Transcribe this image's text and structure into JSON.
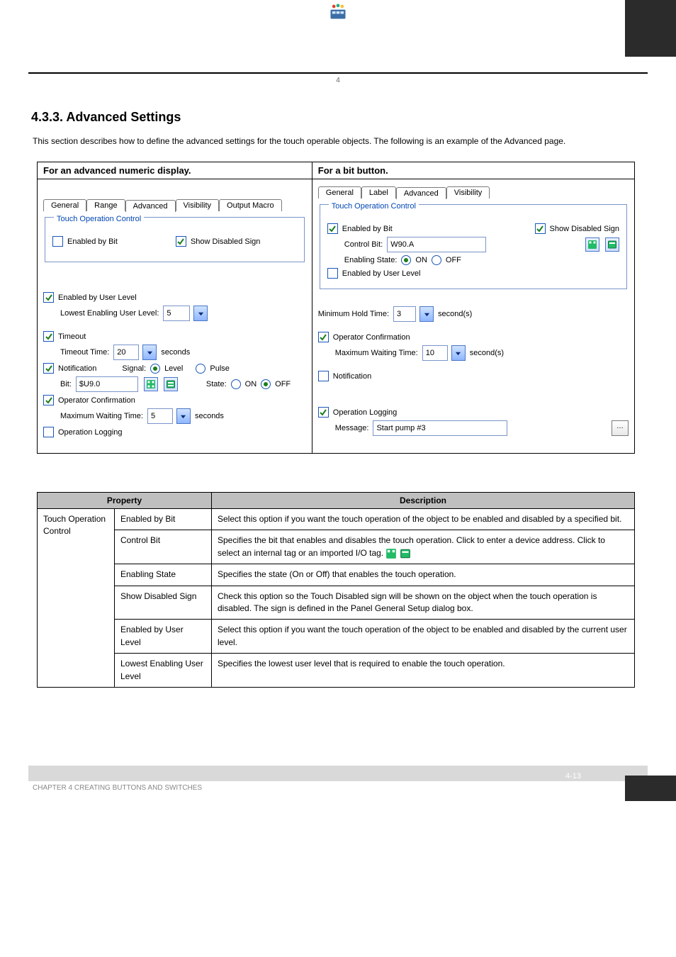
{
  "header": {
    "caption": "4",
    "top_right_page": ""
  },
  "section": {
    "number_title": "4.3.3. Advanced Settings",
    "description": "This section describes how to define the advanced settings for the touch operable objects. The following is an example of the Advanced page."
  },
  "shots": {
    "left_header": "For an advanced numeric display.",
    "right_header": "For a bit button.",
    "left": {
      "tabs": [
        "General",
        "Range",
        "Advanced",
        "Visibility",
        "Output Macro"
      ],
      "active_tab": "Advanced",
      "group_title": "Touch Operation Control",
      "enabled_by_bit": {
        "label": "Enabled by Bit",
        "checked": false
      },
      "show_disabled_sign": {
        "label": "Show Disabled Sign",
        "checked": true
      },
      "enabled_by_user_level": {
        "label": "Enabled by User Level",
        "checked": true
      },
      "lowest_level_label": "Lowest Enabling User Level:",
      "lowest_level_value": "5",
      "timeout": {
        "label": "Timeout",
        "checked": true
      },
      "timeout_time_label": "Timeout Time:",
      "timeout_time_value": "20",
      "timeout_seconds": "seconds",
      "notification": {
        "label": "Notification",
        "checked": true
      },
      "signal_label": "Signal:",
      "signal_options": [
        "Level",
        "Pulse"
      ],
      "signal_sel": "Level",
      "bit_label": "Bit:",
      "bit_value": "$U9.0",
      "state_label": "State:",
      "state_options": [
        "ON",
        "OFF"
      ],
      "state_sel": "OFF",
      "op_confirm": {
        "label": "Operator Confirmation",
        "checked": true
      },
      "max_wait_label": "Maximum Waiting Time:",
      "max_wait_value": "5",
      "max_wait_seconds": "seconds",
      "op_logging": {
        "label": "Operation Logging",
        "checked": false
      }
    },
    "right": {
      "tabs": [
        "General",
        "Label",
        "Advanced",
        "Visibility"
      ],
      "active_tab": "Advanced",
      "group_title": "Touch Operation Control",
      "enabled_by_bit": {
        "label": "Enabled by Bit",
        "checked": true
      },
      "show_disabled_sign": {
        "label": "Show Disabled Sign",
        "checked": true
      },
      "control_bit_label": "Control Bit:",
      "control_bit_value": "W90.A",
      "enabling_state_label": "Enabling State:",
      "enabling_state_options": [
        "ON",
        "OFF"
      ],
      "enabling_state_sel": "ON",
      "enabled_by_user_level": {
        "label": "Enabled by User Level",
        "checked": false
      },
      "min_hold_label": "Minimum Hold Time:",
      "min_hold_value": "3",
      "min_hold_seconds": "second(s)",
      "op_confirm": {
        "label": "Operator Confirmation",
        "checked": true
      },
      "max_wait_label": "Maximum Waiting Time:",
      "max_wait_value": "10",
      "max_wait_seconds": "second(s)",
      "notification": {
        "label": "Notification",
        "checked": false
      },
      "op_logging": {
        "label": "Operation Logging",
        "checked": true
      },
      "message_label": "Message:",
      "message_value": "Start pump #3"
    }
  },
  "prop_table": {
    "headers": [
      "Property",
      "Description"
    ],
    "rows": [
      {
        "c1_rowspan": 5,
        "c1": "Touch Operation Control",
        "c2": "Enabled by Bit",
        "desc": "Select this option if you want the touch operation of the object to be enabled and disabled by a specified bit."
      },
      {
        "c2": "Control Bit",
        "desc": "Specifies the bit that enables and disables the touch operation. Click  to enter a device address. Click  to select an internal tag or an imported I/O tag."
      },
      {
        "c2": "Enabling State",
        "desc": "Specifies the state (On or Off) that enables the touch operation."
      },
      {
        "c2": "Show Disabled Sign",
        "desc": "Check this option so the Touch Disabled sign will be shown on the object when the touch operation is disabled. The sign is defined in the Panel General Setup dialog box."
      },
      {
        "c2": "Enabled by User Level",
        "desc": "Select this option if you want the touch operation of the object to be enabled and disabled by the current user level."
      },
      {
        "c2": "Lowest Enabling User Level",
        "desc": "Specifies the lowest user level that is required to enable the touch operation."
      }
    ]
  },
  "footer": {
    "left_text": "CHAPTER 4   CREATING BUTTONS AND SWITCHES",
    "page_num": "4-13"
  }
}
